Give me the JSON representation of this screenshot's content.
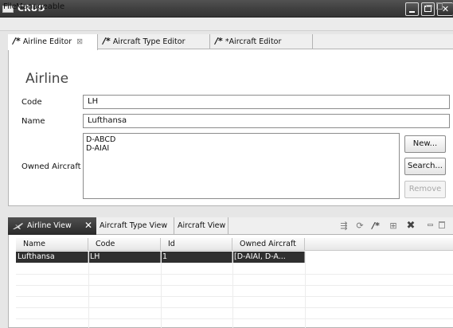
{
  "window": {
    "title": "CRUD",
    "controls": [
      "minimize-icon",
      "maximize-icon",
      "close-icon"
    ]
  },
  "menu": {
    "items": [
      "File",
      "Manageable"
    ]
  },
  "editor_tabs": [
    {
      "label": "Airline Editor",
      "dirty_marker": "/*",
      "active": true,
      "close": "⊠"
    },
    {
      "label": "Aircraft Type Editor",
      "dirty_marker": "/*",
      "active": false
    },
    {
      "label": "*Aircraft Editor",
      "dirty_marker": "/*",
      "active": false
    }
  ],
  "form": {
    "title": "Airline",
    "code_label": "Code",
    "code_value": "LH",
    "name_label": "Name",
    "name_value": "Lufthansa",
    "owned_label": "Owned Aircraft",
    "owned_items": [
      "D-ABCD",
      "D-AIAI"
    ],
    "new_label": "New...",
    "search_label": "Search...",
    "remove_label": "Remove"
  },
  "view_tabs": [
    {
      "label": "Airline View",
      "active": true,
      "icon": "airplane-icon",
      "close": "✕"
    },
    {
      "label": "Aircraft Type View",
      "active": false
    },
    {
      "label": "Aircraft View",
      "active": false
    }
  ],
  "view_toolbar": {
    "tools": [
      "filter-icon",
      "refresh-icon",
      "edit-icon",
      "add-icon",
      "delete-icon"
    ],
    "edit_glyph": "/*",
    "delete_glyph": "✖"
  },
  "table": {
    "columns": [
      "Name",
      "Code",
      "Id",
      "Owned Aircraft"
    ],
    "rows": [
      [
        "Lufthansa",
        "LH",
        "1",
        "[D-AIAI, D-A..."
      ]
    ]
  },
  "colors": {
    "titlebar": "#3f3f3f",
    "selection": "#2f2f2f",
    "active_view_tab": "#2a2a2a"
  }
}
